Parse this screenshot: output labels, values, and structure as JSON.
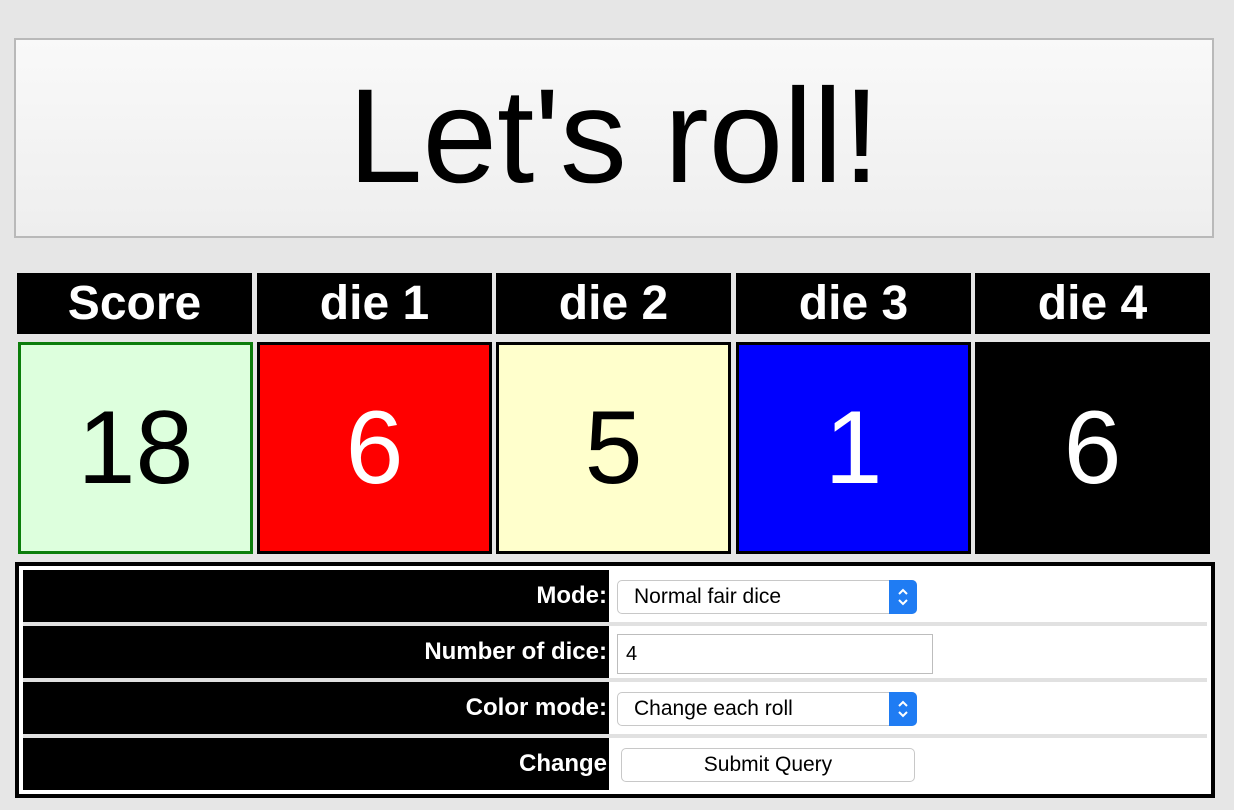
{
  "header": {
    "title": "Let's roll!"
  },
  "table": {
    "headers": [
      "Score",
      "die 1",
      "die 2",
      "die 3",
      "die 4"
    ],
    "values": [
      "18",
      "6",
      "5",
      "1",
      "6"
    ],
    "colors": {
      "score_bg": "#ddffdd",
      "score_border": "#0b7d0b",
      "die1": "#ff0000",
      "die2": "#ffffcc",
      "die3": "#0000ff",
      "die4": "#000000"
    }
  },
  "controls": {
    "mode_label": "Mode:",
    "mode_value": "Normal fair dice",
    "num_dice_label": "Number of dice:",
    "num_dice_value": "4",
    "color_mode_label": "Color mode:",
    "color_mode_value": "Change each roll",
    "change_label": "Change",
    "submit_label": "Submit Query",
    "accent": "#1f7cf3"
  }
}
